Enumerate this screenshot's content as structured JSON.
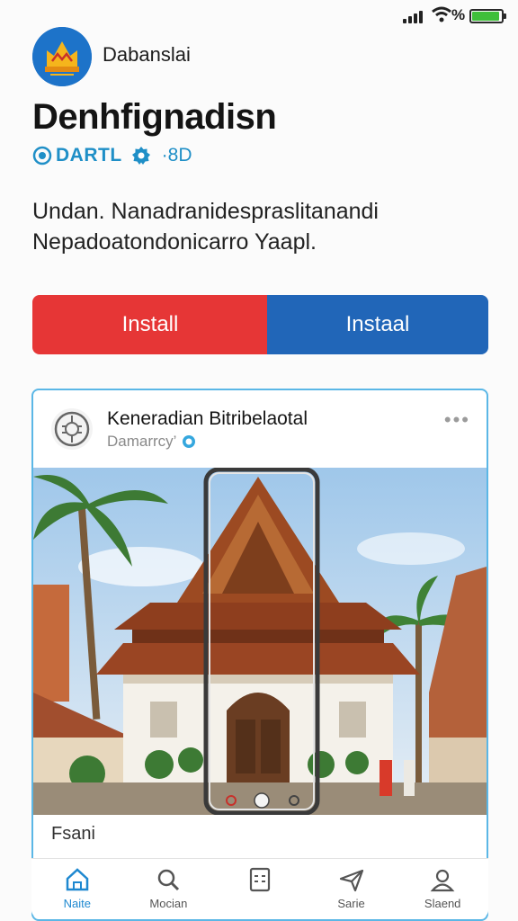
{
  "status": {
    "battery_text": "%",
    "battery_level": 0.95
  },
  "header": {
    "publisher": "Dabanslai",
    "title": "Denhfignadisn",
    "developer": "DARTL",
    "rating_count": "·8D"
  },
  "description": "Undan. Nanadranidespraslitanandi Nepadoatondonicarro Yaapl.",
  "buttons": {
    "install_left": "Install",
    "install_right": "Instaal"
  },
  "card": {
    "title": "Keneradian Bitribelaotal",
    "subtitle": "Damarrcy’",
    "more": "•••",
    "caption": "Fsani"
  },
  "nav": [
    {
      "label": "Naite",
      "icon": "home-icon"
    },
    {
      "label": "Mocian",
      "icon": "search-icon"
    },
    {
      "label": "",
      "icon": "apps-icon"
    },
    {
      "label": "Sarie",
      "icon": "send-icon"
    },
    {
      "label": "Slaend",
      "icon": "profile-icon"
    }
  ],
  "colors": {
    "install_red": "#e63636",
    "install_blue": "#2166b8",
    "accent": "#1f8fc7",
    "card_border": "#5bb7e6"
  }
}
